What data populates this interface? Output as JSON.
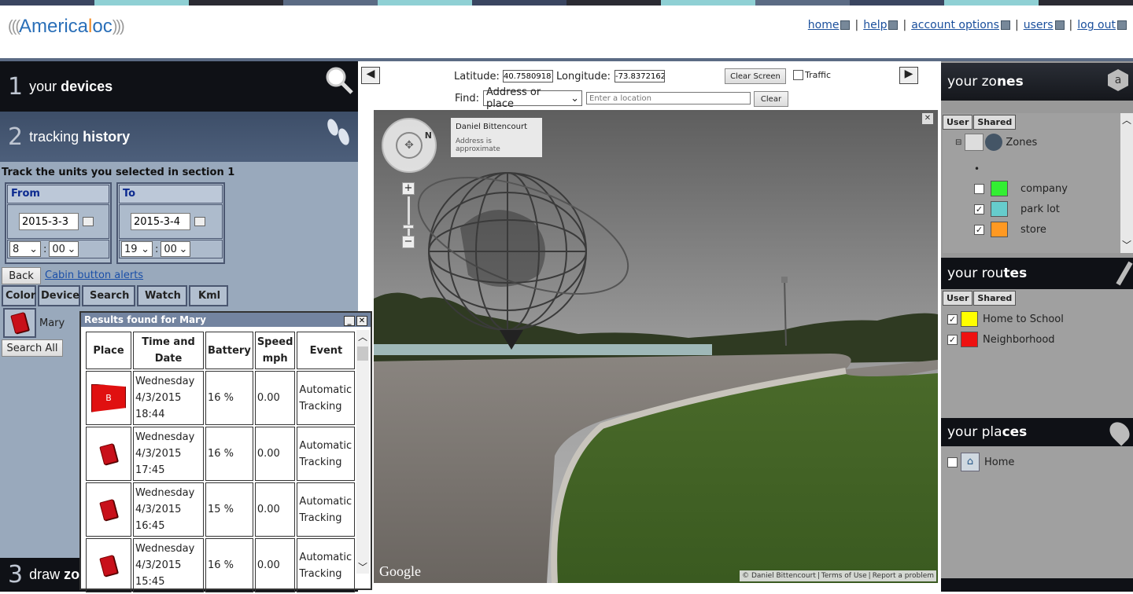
{
  "header": {
    "logo": {
      "before": "America",
      "pin": "l",
      "after": "oc"
    },
    "nav": [
      {
        "label": "home",
        "icon": "home-icon"
      },
      {
        "label": "help",
        "icon": "help-icon"
      },
      {
        "label": "account options",
        "icon": "account-icon"
      },
      {
        "label": "users",
        "icon": "users-icon"
      },
      {
        "label": "log out",
        "icon": "logout-icon"
      }
    ]
  },
  "sections": {
    "devices": {
      "num": "1",
      "pre": "your ",
      "bold": "devices"
    },
    "history": {
      "num": "2",
      "pre": "tracking ",
      "bold": "history"
    },
    "draw": {
      "num": "3",
      "pre": "draw ",
      "bold": "zo"
    }
  },
  "history": {
    "instruction": "Track the units you selected in section 1",
    "from_label": "From",
    "to_label": "To",
    "from_date": "2015-3-3",
    "to_date": "2015-3-4",
    "from_hour": "8",
    "from_min": "00",
    "to_hour": "19",
    "to_min": "00",
    "back": "Back",
    "alerts_link": "Cabin button alerts",
    "columns": [
      "Color",
      "Device",
      "Search",
      "Watch",
      "Kml"
    ],
    "device_name": "Mary",
    "search_all": "Search All"
  },
  "popup": {
    "title": "Results found for Mary",
    "columns": [
      "Place",
      "Time and Date",
      "Battery",
      "Speed mph",
      "Event"
    ],
    "rows": [
      {
        "place": "B",
        "day": "Wednesday",
        "date": "4/3/2015",
        "time": "18:44",
        "battery": "16 %",
        "speed": "0.00",
        "event": "Automatic Tracking"
      },
      {
        "place": "",
        "day": "Wednesday",
        "date": "4/3/2015",
        "time": "17:45",
        "battery": "16 %",
        "speed": "0.00",
        "event": "Automatic Tracking"
      },
      {
        "place": "",
        "day": "Wednesday",
        "date": "4/3/2015",
        "time": "16:45",
        "battery": "15 %",
        "speed": "0.00",
        "event": "Automatic Tracking"
      },
      {
        "place": "",
        "day": "Wednesday",
        "date": "4/3/2015",
        "time": "15:45",
        "battery": "16 %",
        "speed": "0.00",
        "event": "Automatic Tracking"
      }
    ]
  },
  "map": {
    "lat_label": "Latitude:",
    "lat": "40.7580918",
    "lon_label": "Longitude:",
    "lon": "-73.8372162",
    "clear_screen": "Clear Screen",
    "traffic": "Traffic",
    "find_label": "Find:",
    "find_mode": "Address or place",
    "location_placeholder": "Enter a location",
    "clear": "Clear",
    "sv_author": "Daniel Bittencourt",
    "sv_note": "Address is approximate",
    "google": "Google",
    "footer": [
      "© Daniel Bittencourt",
      "Terms of Use",
      "Report a problem"
    ]
  },
  "zones": {
    "title_pre": "your zo",
    "title_bold": "nes",
    "tabs": [
      "User",
      "Shared"
    ],
    "root": "Zones",
    "items": [
      {
        "label": "company",
        "color": "#33ee33",
        "checked": false
      },
      {
        "label": "park lot",
        "color": "#66cccc",
        "checked": true
      },
      {
        "label": "store",
        "color": "#ff9922",
        "checked": true
      }
    ]
  },
  "routes": {
    "title_pre": "your rou",
    "title_bold": "tes",
    "tabs": [
      "User",
      "Shared"
    ],
    "items": [
      {
        "label": "Home to School",
        "color": "#ffff00",
        "checked": true
      },
      {
        "label": "Neighborhood",
        "color": "#ee1111",
        "checked": true
      }
    ]
  },
  "places": {
    "title_pre": "your pla",
    "title_bold": "ces",
    "items": [
      {
        "label": "Home",
        "checked": false
      }
    ]
  }
}
